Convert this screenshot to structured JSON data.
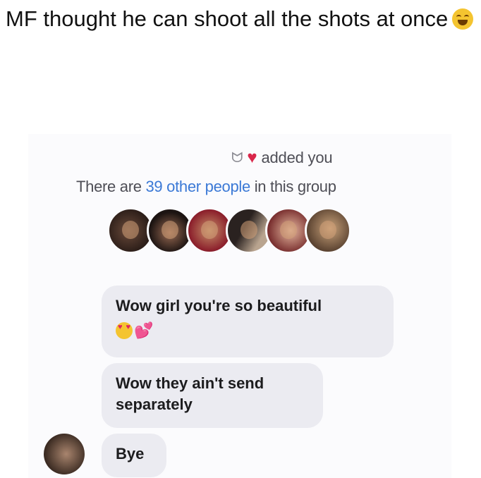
{
  "caption": {
    "text": "MF thought he can shoot all the shots at once",
    "emoji": "rolling-on-floor-laughing-icon"
  },
  "group_header": {
    "added_text": "added you",
    "added_by_icons": [
      "bunny-icon",
      "heart-icon"
    ],
    "count_prefix": "There are ",
    "count_link": "39 other people",
    "count_suffix": " in this group"
  },
  "member_avatars": [
    "avatar-1",
    "avatar-2",
    "avatar-3",
    "avatar-4",
    "avatar-5",
    "avatar-6"
  ],
  "messages": [
    {
      "text": "Wow girl you're so beautiful",
      "emojis": [
        "heart-eyes-icon",
        "two-hearts-icon"
      ]
    },
    {
      "text": "Wow they ain't send separately",
      "emojis": []
    },
    {
      "text": "Bye",
      "emojis": []
    }
  ],
  "colors": {
    "link": "#3b79d6",
    "bubble": "#ebebf1",
    "heart": "#d9264a"
  }
}
